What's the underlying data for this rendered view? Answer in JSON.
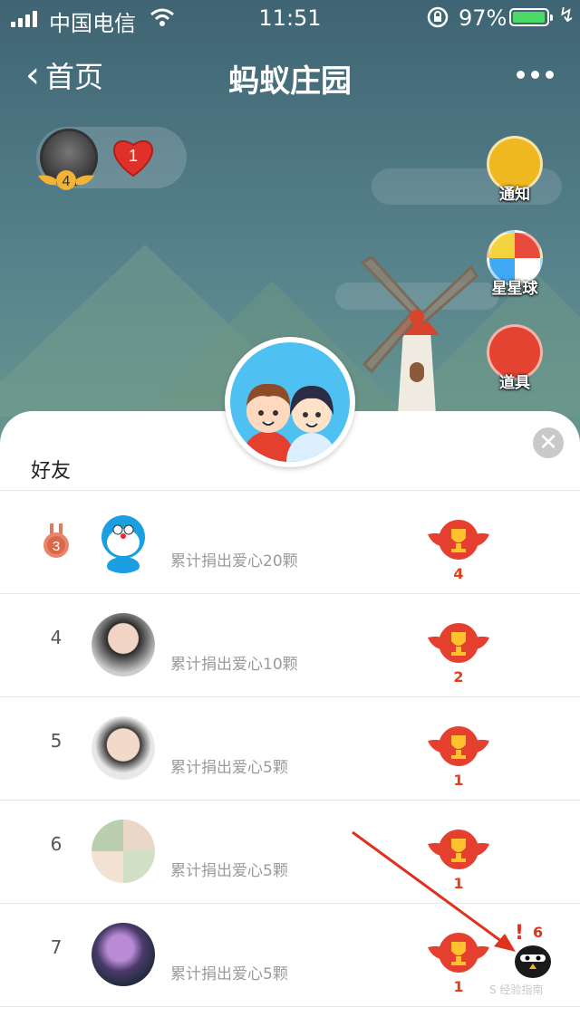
{
  "status_bar": {
    "carrier": "中国电信",
    "time": "11:51",
    "battery_percent": "97%",
    "battery_level": 0.97,
    "icons": [
      "signal-icon",
      "wifi-icon",
      "rotation-lock-icon",
      "battery-icon",
      "charging-icon"
    ]
  },
  "nav": {
    "back_label": "首页",
    "title": "蚂蚁庄园",
    "more_icon": "more-dots-icon"
  },
  "profile": {
    "level": "4",
    "hearts": "1"
  },
  "side_buttons": {
    "notice": "通知",
    "star_ball": "星星球",
    "props": "道具"
  },
  "friends": {
    "section_title": "好友",
    "rows": [
      {
        "rank": "3",
        "donation": "累计捐出爱心20颗",
        "trophies": "4"
      },
      {
        "rank": "4",
        "donation": "累计捐出爱心10颗",
        "trophies": "2"
      },
      {
        "rank": "5",
        "donation": "累计捐出爱心5颗",
        "trophies": "1"
      },
      {
        "rank": "6",
        "donation": "累计捐出爱心5颗",
        "trophies": "1"
      },
      {
        "rank": "7",
        "donation": "累计捐出爱心5颗",
        "trophies": "1"
      }
    ]
  },
  "annotation": {
    "mark": "!",
    "number": "6"
  },
  "watermark": "S 经验指南",
  "colors": {
    "accent_red": "#e23f1d",
    "battery_green": "#4cd964",
    "avatar_blue": "#4ec0f2"
  }
}
